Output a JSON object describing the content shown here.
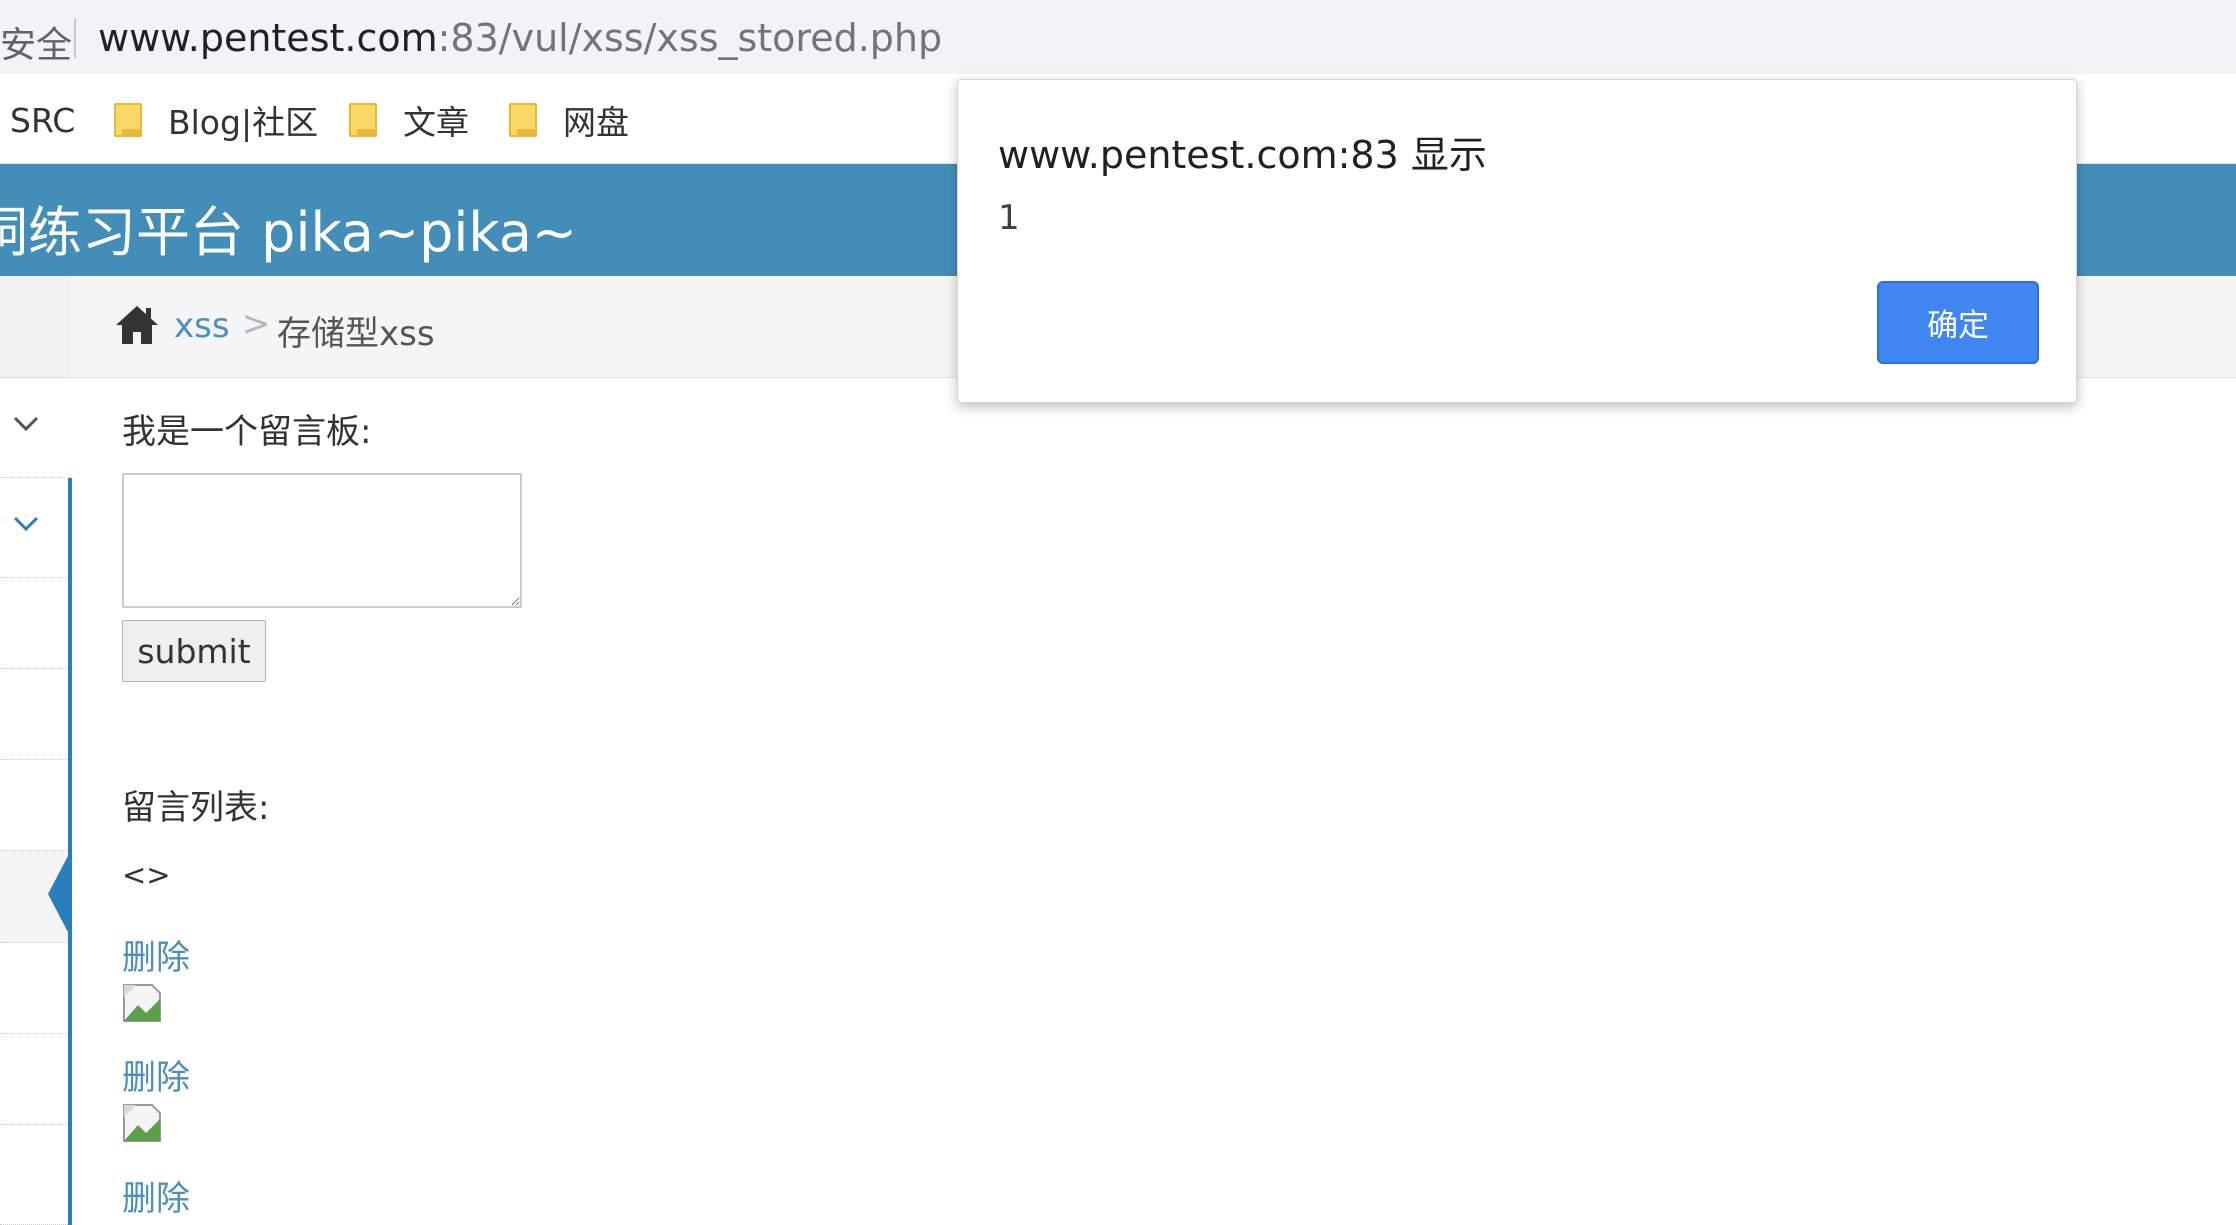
{
  "browser": {
    "security_label": "安全",
    "url_host": "www.pentest.com",
    "url_rest": ":83/vul/xss/xss_stored.php"
  },
  "bookmarks": [
    "SRC",
    "Blog|社区",
    "文章",
    "网盘"
  ],
  "header": {
    "title": "洞练习平台 pika~pika~"
  },
  "breadcrumb": {
    "section": "xss",
    "separator": ">",
    "current": "存储型xss"
  },
  "form": {
    "board_label": "我是一个留言板:",
    "textarea_value": "",
    "submit_label": "submit"
  },
  "list": {
    "title": "留言列表:",
    "first_entry_text": "<>",
    "delete_label": "删除"
  },
  "alert": {
    "title": "www.pentest.com:83 显示",
    "message": "1",
    "ok_label": "确定",
    "button_color": "#3f86f0"
  },
  "colors": {
    "header": "#438eb9",
    "link": "#4c8fbd",
    "sidebar_accent": "#2b7dbc"
  },
  "icons": [
    "home-icon",
    "folder-icon",
    "chevron-down-icon",
    "broken-image-icon"
  ]
}
